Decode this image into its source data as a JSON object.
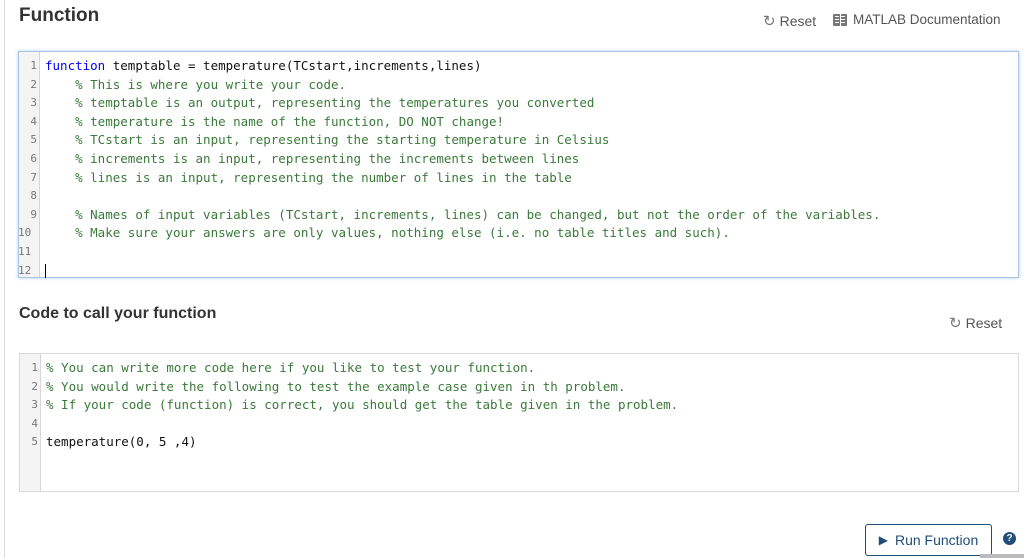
{
  "function_section": {
    "title": "Function",
    "reset_label": "Reset",
    "reset_icon": "refresh-icon",
    "docs_label": "MATLAB Documentation",
    "docs_icon": "book-icon",
    "lines": [
      {
        "n": "1",
        "parts": [
          {
            "t": "kw",
            "s": "function"
          },
          {
            "t": "pl",
            "s": " temptable = temperature(TCstart,increments,lines)"
          }
        ]
      },
      {
        "n": "2",
        "parts": [
          {
            "t": "pl",
            "s": "    "
          },
          {
            "t": "cm",
            "s": "% This is where you write your code."
          }
        ]
      },
      {
        "n": "3",
        "parts": [
          {
            "t": "pl",
            "s": "    "
          },
          {
            "t": "cm",
            "s": "% temptable is an output, representing the temperatures you converted"
          }
        ]
      },
      {
        "n": "4",
        "parts": [
          {
            "t": "pl",
            "s": "    "
          },
          {
            "t": "cm",
            "s": "% temperature is the name of the function, DO NOT change!"
          }
        ]
      },
      {
        "n": "5",
        "parts": [
          {
            "t": "pl",
            "s": "    "
          },
          {
            "t": "cm",
            "s": "% TCstart is an input, representing the starting temperature in Celsius"
          }
        ]
      },
      {
        "n": "6",
        "parts": [
          {
            "t": "pl",
            "s": "    "
          },
          {
            "t": "cm",
            "s": "% increments is an input, representing the increments between lines"
          }
        ]
      },
      {
        "n": "7",
        "parts": [
          {
            "t": "pl",
            "s": "    "
          },
          {
            "t": "cm",
            "s": "% lines is an input, representing the number of lines in the table"
          }
        ]
      },
      {
        "n": "8",
        "parts": []
      },
      {
        "n": "9",
        "parts": [
          {
            "t": "pl",
            "s": "    "
          },
          {
            "t": "cm",
            "s": "% Names of input variables (TCstart, increments, lines) can be changed, but not the order of the variables."
          }
        ]
      },
      {
        "n": "10",
        "parts": [
          {
            "t": "pl",
            "s": "    "
          },
          {
            "t": "cm",
            "s": "% Make sure your answers are only values, nothing else (i.e. no table titles and such)."
          }
        ]
      },
      {
        "n": "11",
        "parts": []
      },
      {
        "n": "12",
        "parts": [
          {
            "t": "cursor",
            "s": ""
          }
        ]
      }
    ]
  },
  "call_section": {
    "title": "Code to call your function",
    "reset_label": "Reset",
    "reset_icon": "refresh-icon",
    "lines": [
      {
        "n": "1",
        "parts": [
          {
            "t": "cm",
            "s": "% You can write more code here if you like to test your function."
          }
        ]
      },
      {
        "n": "2",
        "parts": [
          {
            "t": "cm",
            "s": "% You would write the following to test the example case given in th problem."
          }
        ]
      },
      {
        "n": "3",
        "parts": [
          {
            "t": "cm",
            "s": "% If your code (function) is correct, you should get the table given in the problem."
          }
        ]
      },
      {
        "n": "4",
        "parts": []
      },
      {
        "n": "5",
        "parts": [
          {
            "t": "pl",
            "s": "temperature(0, 5 ,4)"
          }
        ]
      }
    ]
  },
  "footer": {
    "run_label": "Run Function",
    "run_icon": "play-icon",
    "help_icon": "help-icon",
    "help_glyph": "?"
  },
  "colors": {
    "keyword": "#0000ff",
    "comment": "#3a7a3a",
    "run_button": "#1f4e79",
    "editor_focus_border": "#a9c6e8"
  }
}
